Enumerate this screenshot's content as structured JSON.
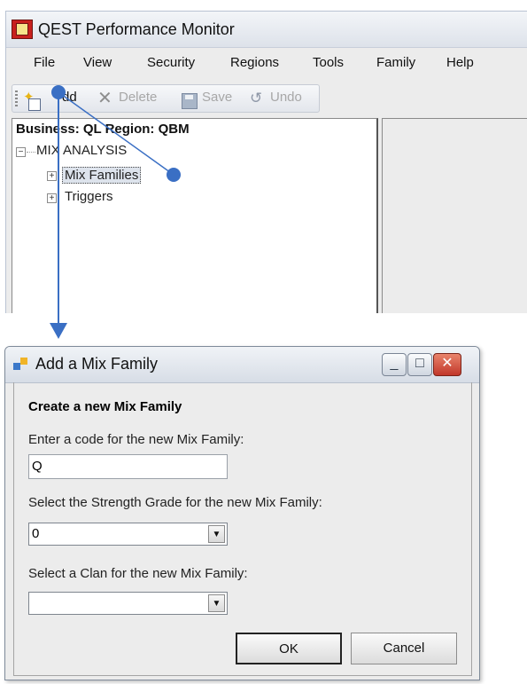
{
  "main_window": {
    "title": "QEST Performance Monitor",
    "menu": [
      "File",
      "View",
      "Security",
      "Regions",
      "Tools",
      "Family",
      "Help"
    ],
    "toolbar": {
      "add_label": "dd",
      "delete_label": "Delete",
      "save_label": "Save",
      "undo_label": "Undo"
    },
    "tree": {
      "header": "Business: QL  Region: QBM",
      "root_label": "MIX ANALYSIS",
      "children": [
        "Mix Families",
        "Triggers"
      ]
    }
  },
  "dialog": {
    "title": "Add a Mix Family",
    "heading": "Create a new Mix Family",
    "code_label": "Enter a code for the new Mix Family:",
    "code_value": "Q",
    "strength_label": "Select the Strength Grade for the new Mix Family:",
    "strength_value": "0",
    "clan_label": "Select a Clan for the new Mix Family:",
    "clan_value": "",
    "ok_label": "OK",
    "cancel_label": "Cancel"
  },
  "colors": {
    "annotation": "#3a6fc4",
    "window_bg": "#ececec",
    "close_button": "#c1372a"
  },
  "icons": [
    "app-logo-icon",
    "add-icon",
    "delete-icon",
    "save-icon",
    "undo-icon",
    "dialog-app-icon",
    "minimize-icon",
    "maximize-icon",
    "close-icon",
    "dropdown-arrow-icon"
  ]
}
